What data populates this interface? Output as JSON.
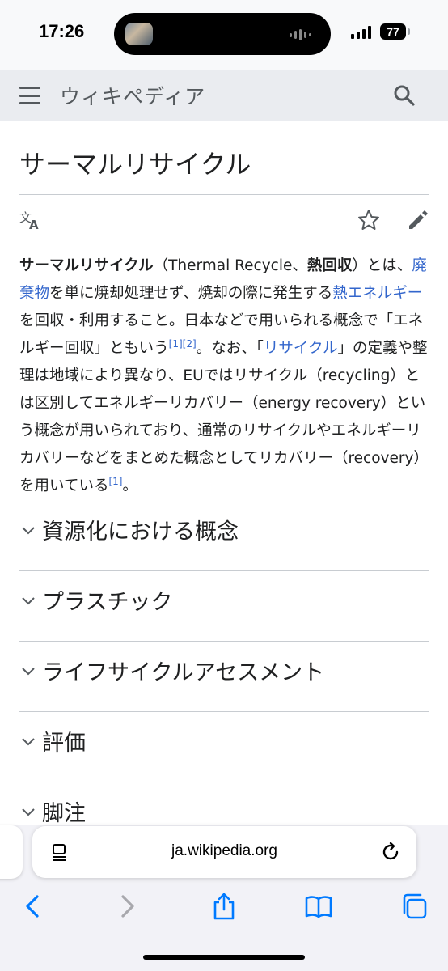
{
  "status_bar": {
    "time": "17:26",
    "battery": "77"
  },
  "header": {
    "site_name": "ウィキペディア"
  },
  "article": {
    "title": "サーマルリサイクル",
    "lead": {
      "term": "サーマルリサイクル",
      "t1": "（Thermal Recycle、",
      "t1b": "熱回収",
      "t2": "）とは、",
      "link_waste": "廃棄物",
      "t3": "を単に焼却処理せず、焼却の際に発生する",
      "link_heat": "熱エネルギー",
      "t4": "を回収・利用すること。日本などで用いられる概念で「エネルギー回収」ともいう",
      "ref1": "[1]",
      "ref2": "[2]",
      "t5": "。なお、「",
      "link_recycle": "リサイクル",
      "t6": "」の定義や整理は地域により異なり、EUではリサイクル（recycling）とは区別してエネルギーリカバリー（energy recovery）という概念が用いられており、通常のリサイクルやエネルギーリカバリーなどをまとめた概念としてリカバリー（recovery）を用いている",
      "ref3": "[1]",
      "t7": "。"
    },
    "sections": [
      "資源化における概念",
      "プラスチック",
      "ライフサイクルアセスメント",
      "評価",
      "脚注"
    ]
  },
  "browser": {
    "url": "ja.wikipedia.org"
  }
}
